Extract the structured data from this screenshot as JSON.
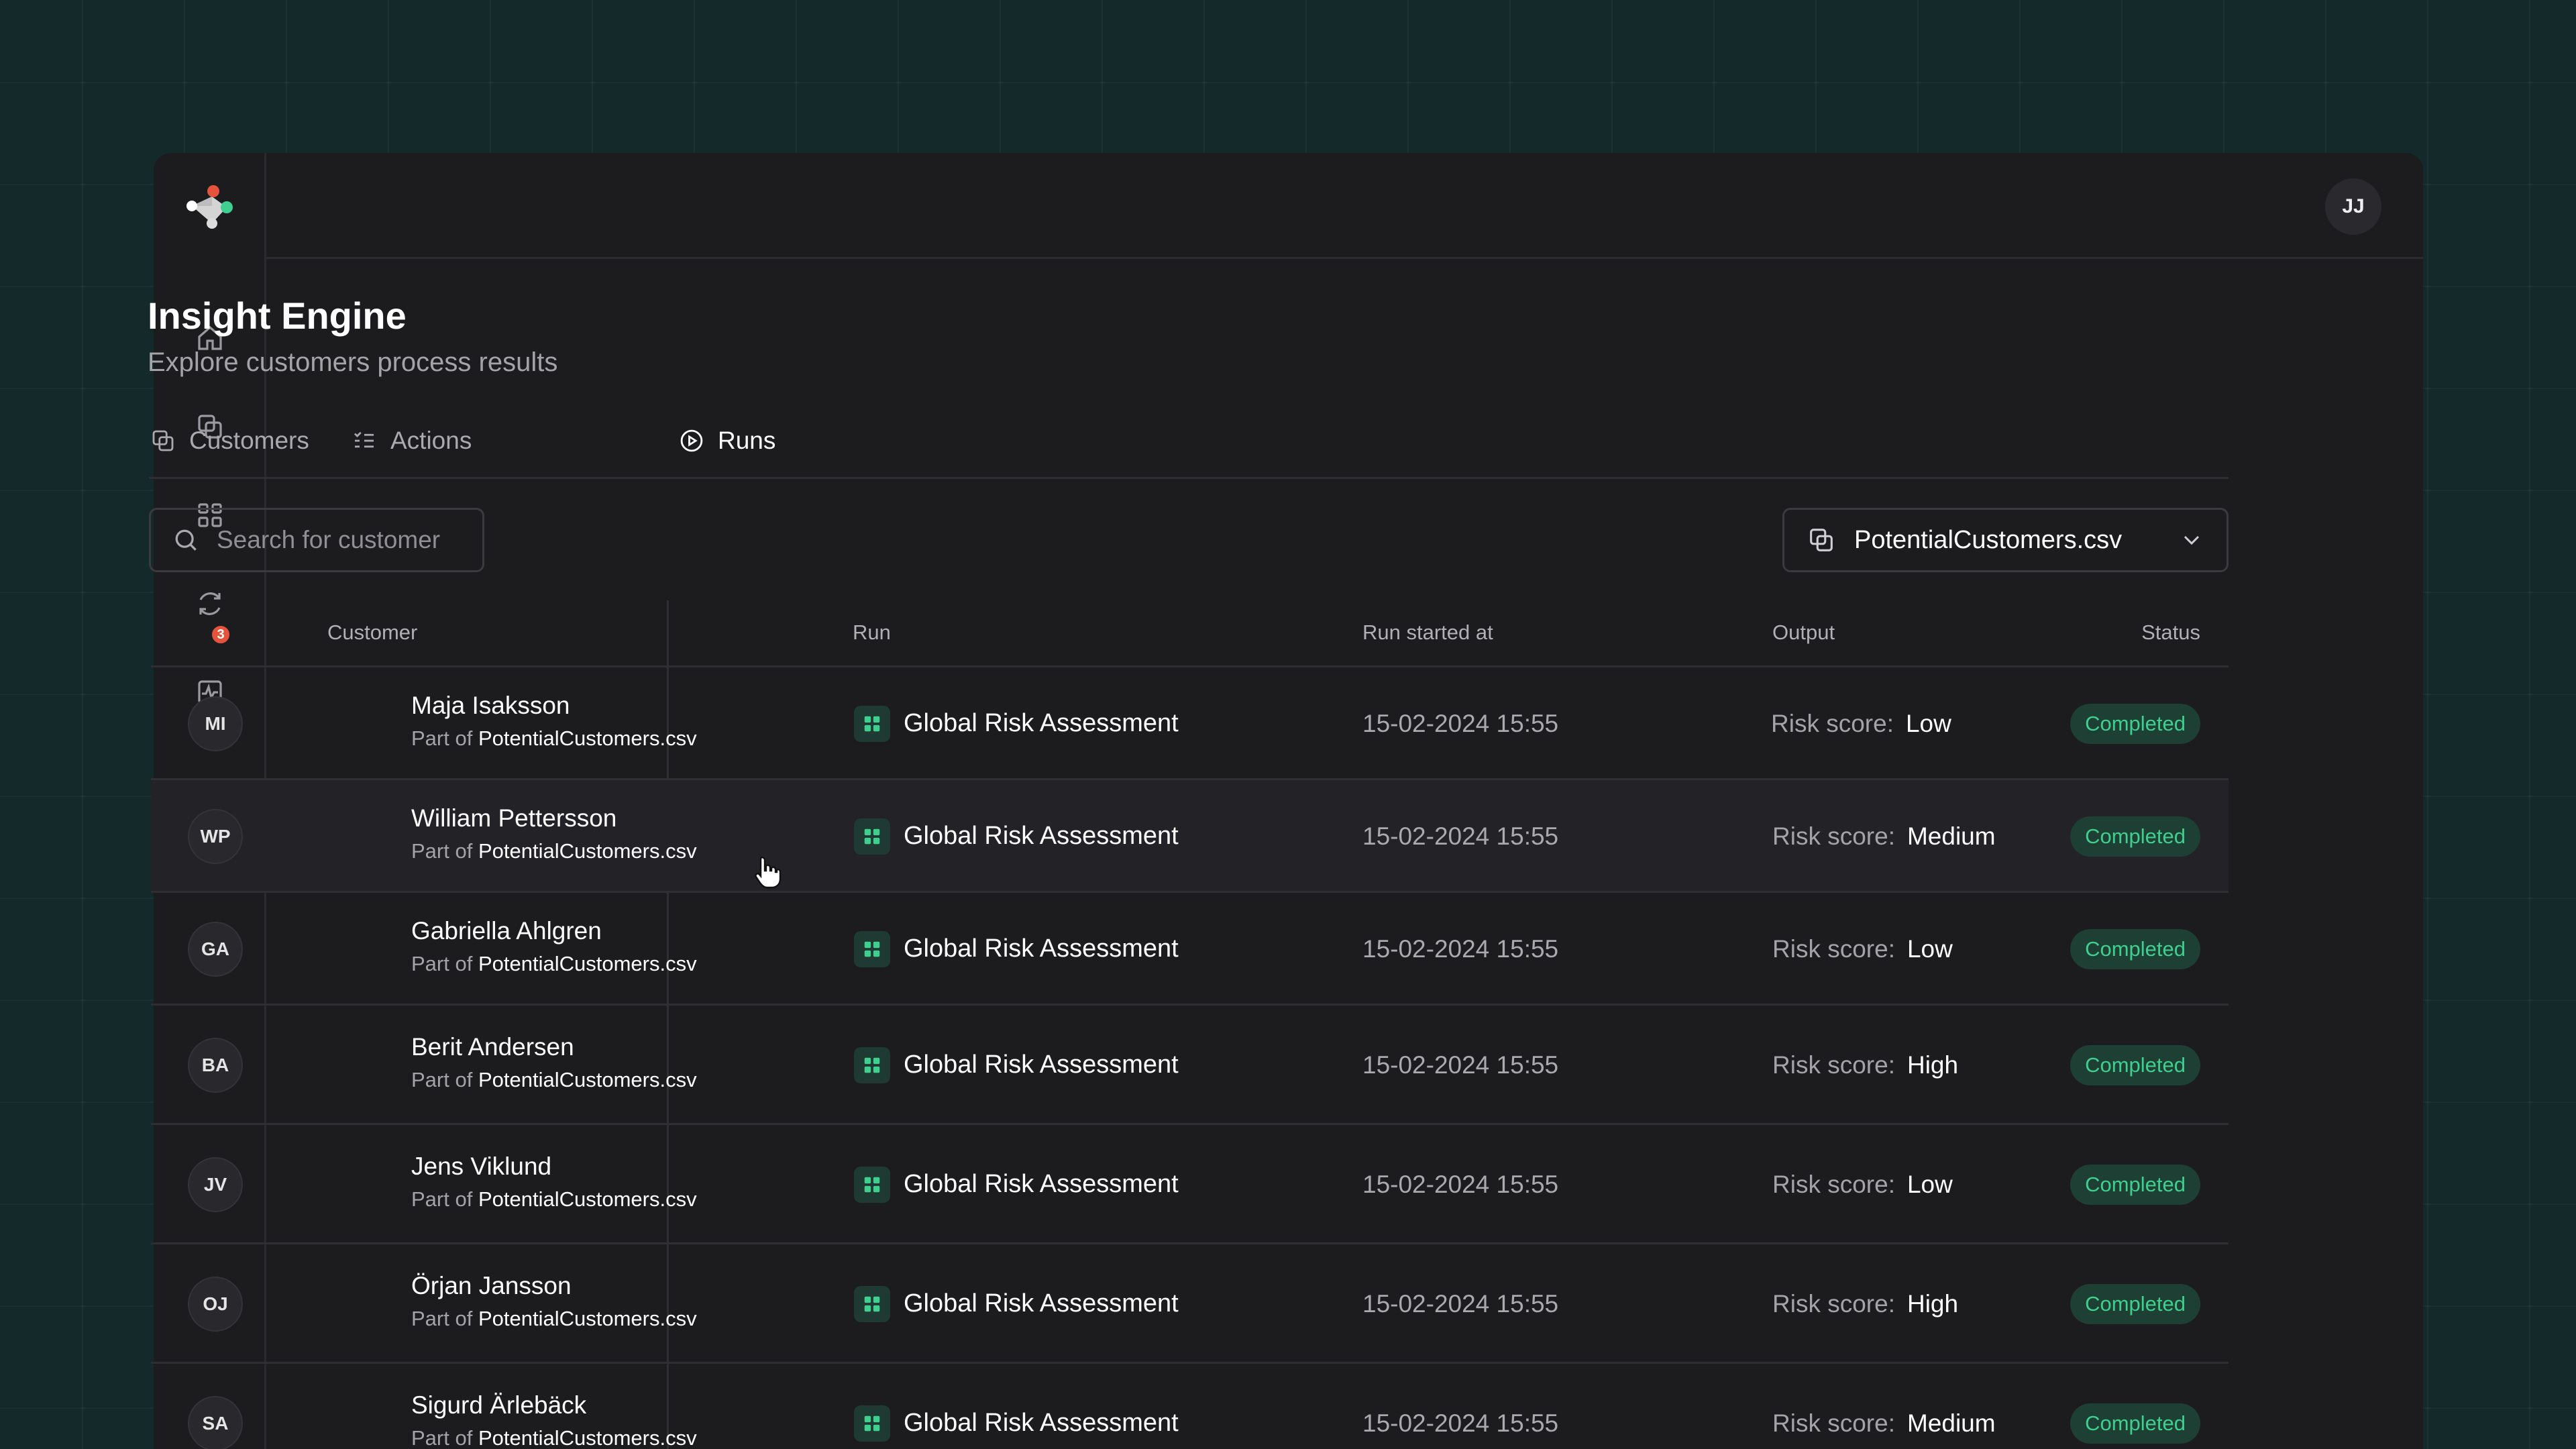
{
  "user": {
    "initials": "JJ"
  },
  "sidebar": {
    "items": [
      {
        "name": "home-icon"
      },
      {
        "name": "copy-icon"
      },
      {
        "name": "grid-icon"
      },
      {
        "name": "refresh-icon"
      },
      {
        "name": "activity-icon",
        "badge": "3"
      }
    ]
  },
  "header": {
    "title": "Insight Engine",
    "subtitle": "Explore customers process results"
  },
  "tabs": [
    {
      "label": "Customers",
      "icon": "copy-icon"
    },
    {
      "label": "Actions",
      "icon": "list-icon"
    },
    {
      "label": "Runs",
      "icon": "play-circle-icon",
      "active": true
    }
  ],
  "search": {
    "placeholder": "Search for customer"
  },
  "file_select": {
    "value": "PotentialCustomers.csv"
  },
  "table": {
    "columns": {
      "customer": "Customer",
      "run": "Run",
      "started": "Run started at",
      "output": "Output",
      "status": "Status"
    },
    "part_of_label": "Part of",
    "risk_label": "Risk score:",
    "rows": [
      {
        "initials": "MI",
        "name": "Maja Isaksson",
        "file": "PotentialCustomers.csv",
        "run": "Global Risk Assessment",
        "started": "15-02-2024 15:55",
        "risk": "Low",
        "status": "Completed"
      },
      {
        "initials": "WP",
        "name": "William Pettersson",
        "file": "PotentialCustomers.csv",
        "run": "Global Risk Assessment",
        "started": "15-02-2024 15:55",
        "risk": "Medium",
        "status": "Completed"
      },
      {
        "initials": "GA",
        "name": "Gabriella Ahlgren",
        "file": "PotentialCustomers.csv",
        "run": "Global Risk Assessment",
        "started": "15-02-2024 15:55",
        "risk": "Low",
        "status": "Completed"
      },
      {
        "initials": "BA",
        "name": "Berit Andersen",
        "file": "PotentialCustomers.csv",
        "run": "Global Risk Assessment",
        "started": "15-02-2024 15:55",
        "risk": "High",
        "status": "Completed"
      },
      {
        "initials": "JV",
        "name": "Jens Viklund",
        "file": "PotentialCustomers.csv",
        "run": "Global Risk Assessment",
        "started": "15-02-2024 15:55",
        "risk": "Low",
        "status": "Completed"
      },
      {
        "initials": "OJ",
        "name": "Örjan Jansson",
        "file": "PotentialCustomers.csv",
        "run": "Global Risk Assessment",
        "started": "15-02-2024 15:55",
        "risk": "High",
        "status": "Completed"
      },
      {
        "initials": "SA",
        "name": "Sigurd Ärlebäck",
        "file": "PotentialCustomers.csv",
        "run": "Global Risk Assessment",
        "started": "15-02-2024 15:55",
        "risk": "Medium",
        "status": "Completed"
      }
    ]
  },
  "colors": {
    "accent_green": "#3fcf8e",
    "badge_red": "#e5533c",
    "background": "#13292a"
  }
}
